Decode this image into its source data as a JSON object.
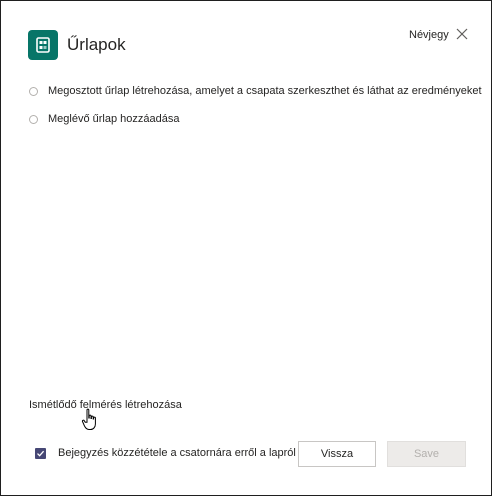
{
  "header": {
    "app_title": "Űrlapok",
    "about_link": "Névjegy",
    "app_icon": "forms-icon",
    "close_icon": "close-icon"
  },
  "options": [
    {
      "label": "Megosztott űrlap létrehozása, amelyet a csapata szerkeszthet és láthat az eredményeket",
      "selected": false
    },
    {
      "label": "Meglévő űrlap hozzáadása",
      "selected": false
    }
  ],
  "links": {
    "recurring_survey": "Ismétlődő felmérés létrehozása"
  },
  "footer": {
    "post_checkbox_label": "Bejegyzés közzététele a csatornára erről a lapról",
    "post_checkbox_checked": true,
    "back_label": "Vissza",
    "save_label": "Save"
  },
  "colors": {
    "app_icon_bg": "#077568",
    "checkbox_bg": "#464775",
    "disabled_button_bg": "#edebe9",
    "disabled_text": "#b3b0ad"
  }
}
